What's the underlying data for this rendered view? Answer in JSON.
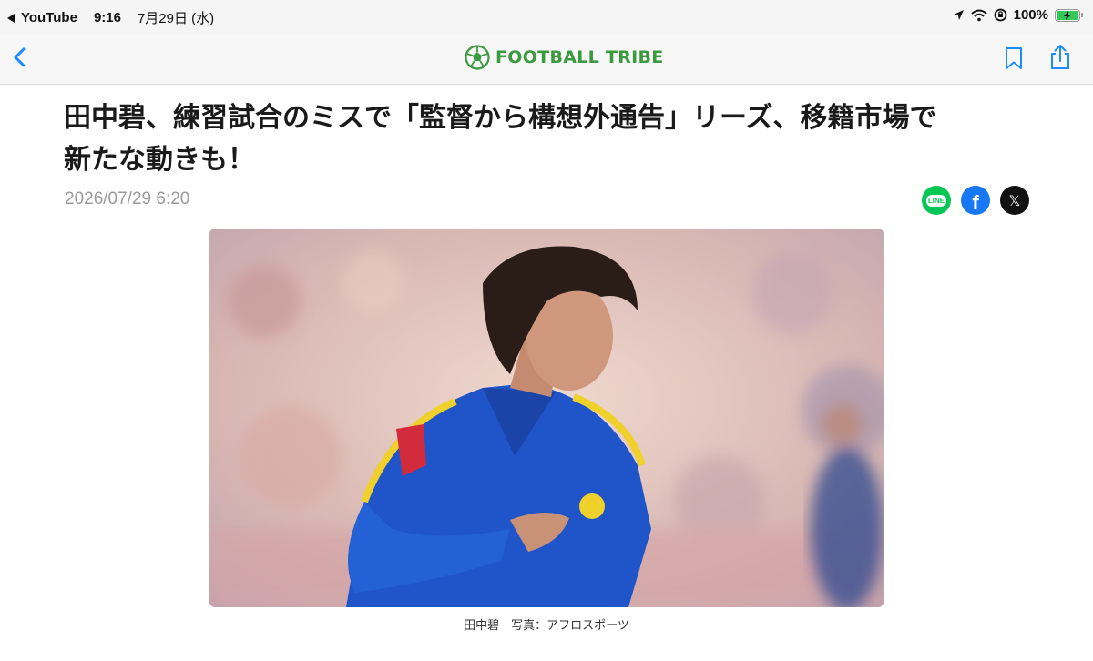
{
  "status_bar": {
    "back_app": "YouTube",
    "time": "9:16",
    "date": "7月29日 (水)",
    "battery": "100%"
  },
  "nav": {
    "brand": "FOOTBALL TRIBE",
    "brand_color": "#3b9a3e"
  },
  "article": {
    "title_line1": "田中碧、練習試合のミスで「監督から構想外通告」リーズ、移籍市場で",
    "title_line2": "新たな動きも！",
    "date": "2026/07/29 6:20",
    "share": {
      "line_label": "LINE",
      "facebook_label": "f",
      "x_label": "𝕏"
    },
    "photo_caption": "田中碧　写真：アフロスポーツ"
  },
  "colors": {
    "line_green": "#06c755",
    "facebook_blue": "#1877f2",
    "nav_accent": "#1a8cff"
  },
  "icons": [
    "back-icon",
    "location-arrow-icon",
    "wifi-icon",
    "orientation-lock-icon",
    "battery-icon",
    "soccer-ball-logo",
    "chevron-left-icon",
    "bookmark-icon",
    "share-icon",
    "line-icon",
    "facebook-icon",
    "x-icon"
  ]
}
